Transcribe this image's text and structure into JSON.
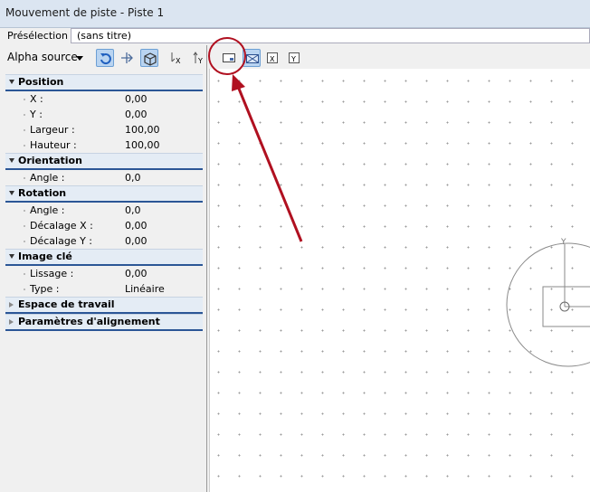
{
  "window": {
    "title": "Mouvement de piste - Piste 1"
  },
  "preset": {
    "label": "Présélection :",
    "value": "(sans titre)"
  },
  "toolbar": {
    "source_label": "Alpha source",
    "icons": [
      "rotate-icon",
      "pan-icon",
      "cube-icon",
      "x-align-icon",
      "y-align-icon",
      "frame-icon",
      "fit-frame-icon",
      "x-box-icon",
      "y-box-icon"
    ]
  },
  "sections": {
    "position": {
      "title": "Position",
      "rows": [
        {
          "label": "X :",
          "value": "0,00"
        },
        {
          "label": "Y :",
          "value": "0,00"
        },
        {
          "label": "Largeur :",
          "value": "100,00"
        },
        {
          "label": "Hauteur :",
          "value": "100,00"
        }
      ]
    },
    "orientation": {
      "title": "Orientation",
      "rows": [
        {
          "label": "Angle :",
          "value": "0,0"
        }
      ]
    },
    "rotation": {
      "title": "Rotation",
      "rows": [
        {
          "label": "Angle :",
          "value": "0,0"
        },
        {
          "label": "Décalage X :",
          "value": "0,00"
        },
        {
          "label": "Décalage Y :",
          "value": "0,00"
        }
      ]
    },
    "keyframe": {
      "title": "Image clé",
      "rows": [
        {
          "label": "Lissage :",
          "value": "0,00"
        },
        {
          "label": "Type :",
          "value": "Linéaire"
        }
      ]
    },
    "workspace": {
      "title": "Espace de travail"
    },
    "alignment": {
      "title": "Paramètres d'alignement"
    }
  },
  "canvas": {
    "axis_label": "Y",
    "accent": "#b01020"
  }
}
